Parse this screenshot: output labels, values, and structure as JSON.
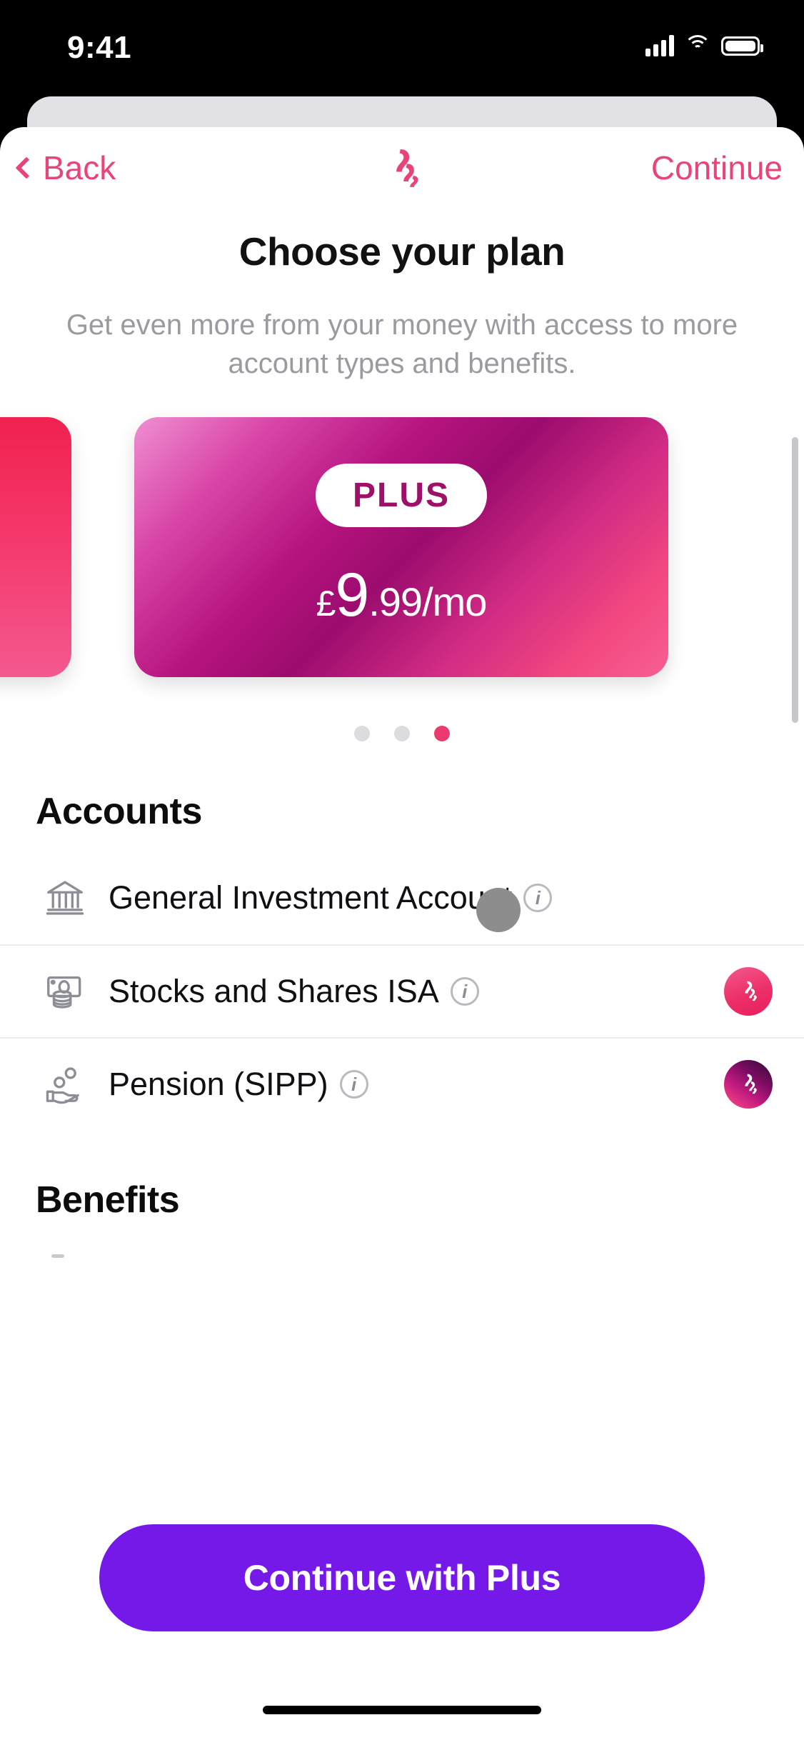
{
  "status_bar": {
    "time": "9:41",
    "signal_icon": "cellular-signal-icon",
    "wifi_icon": "wifi-icon",
    "battery_icon": "battery-icon"
  },
  "nav": {
    "back_label": "Back",
    "back_icon": "chevron-left-icon",
    "logo_icon": "freetrade-logo-icon",
    "continue_label": "Continue"
  },
  "header": {
    "title": "Choose your plan",
    "subtitle": "Get even more from your money with access to more account types and benefits."
  },
  "carousel": {
    "cards": [
      {
        "name": "standard-plan-card",
        "partial": true
      },
      {
        "name": "plus-plan-card",
        "badge": "PLUS",
        "price_currency": "£",
        "price_major": "9",
        "price_minor": ".99/mo"
      }
    ],
    "dots": [
      {
        "active": false
      },
      {
        "active": false
      },
      {
        "active": true
      }
    ],
    "active_index": 3,
    "dot_count": 3
  },
  "accounts": {
    "heading": "Accounts",
    "items": [
      {
        "label": "General Investment Account",
        "icon": "bank-building-icon",
        "info_icon": "info-circle-icon",
        "badge": null
      },
      {
        "label": "Stocks and Shares ISA",
        "icon": "banknote-coins-icon",
        "info_icon": "info-circle-icon",
        "badge": "standard-tier-badge"
      },
      {
        "label": "Pension (SIPP)",
        "icon": "hand-coins-icon",
        "info_icon": "info-circle-icon",
        "badge": "plus-tier-badge"
      }
    ]
  },
  "benefits": {
    "heading": "Benefits"
  },
  "cta": {
    "label": "Continue with Plus"
  },
  "colors": {
    "accent_pink": "#e8447a",
    "dot_active": "#ea3a6f",
    "cta_purple": "#7519e8",
    "plus_badge_text": "#9e1168",
    "subtitle_gray": "#9a9aa0"
  }
}
